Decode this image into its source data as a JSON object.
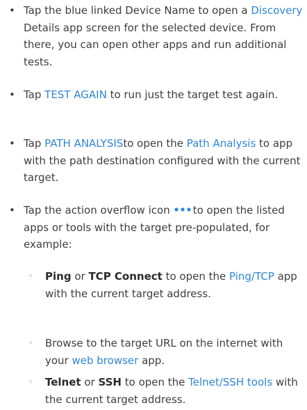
{
  "list": {
    "item1": {
      "pre": "Tap the blue linked Device Name to open a ",
      "link": "Discovery",
      "post": " Details app screen for the selected device. From there, you can open other apps and run additional tests."
    },
    "item2": {
      "pre": "Tap ",
      "link": "TEST AGAIN",
      "post": " to run just the target test again."
    },
    "item3": {
      "pre": "Tap ",
      "link": "PATH ANALYSIS",
      "mid": "to open the ",
      "link2": "Path Analysis",
      "post": " to app with the path destination configured with the current target."
    },
    "item4": {
      "pre": "Tap the action overflow icon",
      "icon": "action-overflow-icon",
      "post": "to open the listed apps or tools with the target pre-populated, for example:"
    },
    "sub1": {
      "strong1": "Ping",
      "or": " or ",
      "strong2": "TCP Connect",
      "mid": " to open the ",
      "link": "Ping/TCP",
      "post": " app with the current target address."
    },
    "sub2": {
      "pre": "Browse to the target URL on the internet with your ",
      "link": "web browser",
      "post": " app."
    },
    "sub3": {
      "strong1": "Telnet",
      "or": " or ",
      "strong2": "SSH",
      "mid": " to open the ",
      "link": "Telnet/SSH tools",
      "post": " with the current target address."
    },
    "bullet_main": "•",
    "bullet_sub": "◦"
  },
  "colors": {
    "text": "#3d3d3d",
    "link": "#2f86d6"
  }
}
